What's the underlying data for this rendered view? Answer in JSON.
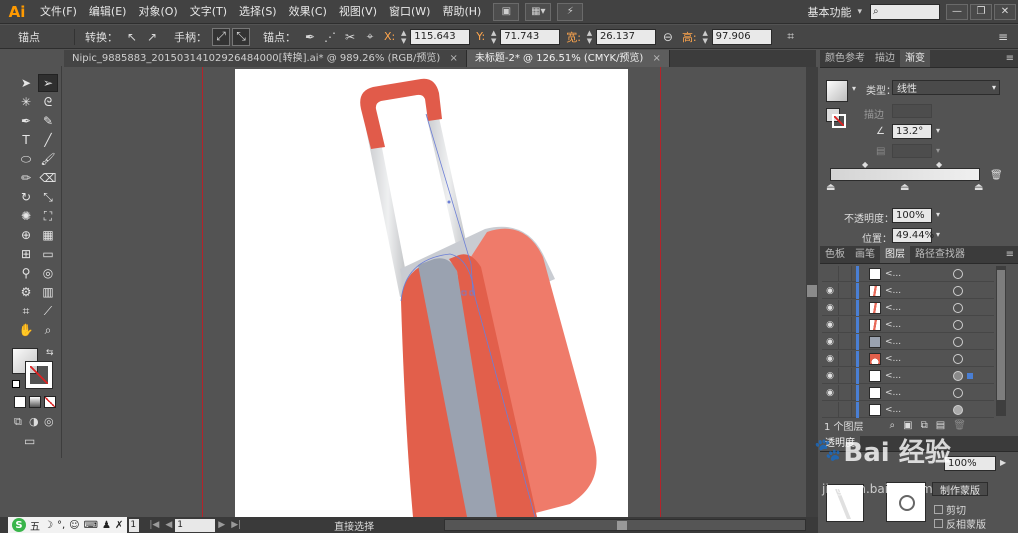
{
  "app": {
    "logo": "Ai"
  },
  "menu": {
    "items": [
      "文件(F)",
      "编辑(E)",
      "对象(O)",
      "文字(T)",
      "选择(S)",
      "效果(C)",
      "视图(V)",
      "窗口(W)",
      "帮助(H)"
    ],
    "workspace": "基本功能"
  },
  "controlbar": {
    "anchor_label": "锚点",
    "convert_label": "转换：",
    "handle_label": "手柄：",
    "anchors_label": "锚点：",
    "x_label": "X:",
    "x_value": "115.643",
    "y_label": "Y:",
    "y_value": "71.743",
    "w_label": "宽:",
    "w_value": "26.137",
    "h_label": "高:",
    "h_value": "97.906"
  },
  "tabs": [
    {
      "label": "Nipic_9885883_20150314102926484000[转换].ai* @ 989.26% (RGB/预览)",
      "active": false
    },
    {
      "label": "未标题-2* @ 126.51% (CMYK/预览)",
      "active": true
    }
  ],
  "statusbar": {
    "ime_text": "五",
    "zoom_value": "1",
    "page_value": "1",
    "tool_status": "直接选择"
  },
  "gradient_panel": {
    "tabs": [
      "颜色参考",
      "描边",
      "渐变"
    ],
    "type_label": "类型：",
    "type_value": "线性",
    "stroke_label": "描边",
    "angle_value": "13.2°",
    "opacity_label": "不透明度：",
    "opacity_value": "100%",
    "location_label": "位置：",
    "location_value": "49.44%"
  },
  "layers_panel": {
    "tabs": [
      "色板",
      "画笔",
      "图层",
      "路径查找器"
    ],
    "rows": [
      {
        "name": "<...",
        "thumb": "#ffffff"
      },
      {
        "name": "<...",
        "thumb": "#e86a5a"
      },
      {
        "name": "<...",
        "thumb": "#e86a5a"
      },
      {
        "name": "<...",
        "thumb": "#e86a5a"
      },
      {
        "name": "<...",
        "thumb": "#9aa2b0"
      },
      {
        "name": "<...",
        "thumb": "#e25f4b"
      },
      {
        "name": "<...",
        "thumb": "#ffffff"
      },
      {
        "name": "<...",
        "thumb": "#ffffff"
      },
      {
        "name": "<...",
        "thumb": "#ffffff"
      }
    ],
    "footer": "1 个图层"
  },
  "transparency_panel": {
    "tabs": [
      "透明度"
    ],
    "opacity_value": "100%",
    "make_mask_label": "制作蒙版",
    "clip_label": "剪切",
    "invert_label": "反相蒙版"
  },
  "watermark": {
    "text": "Bai 经验",
    "sub": "jingyan.baidu.com"
  },
  "colors": {
    "suitcase_body_dark": "#e25f4b",
    "suitcase_body_light": "#ef7b6a",
    "suitcase_stripe": "#9aa2b0",
    "handle_red": "#e15b4a",
    "handle_grey": "#d8dadc",
    "guide_red": "#b4232a"
  }
}
